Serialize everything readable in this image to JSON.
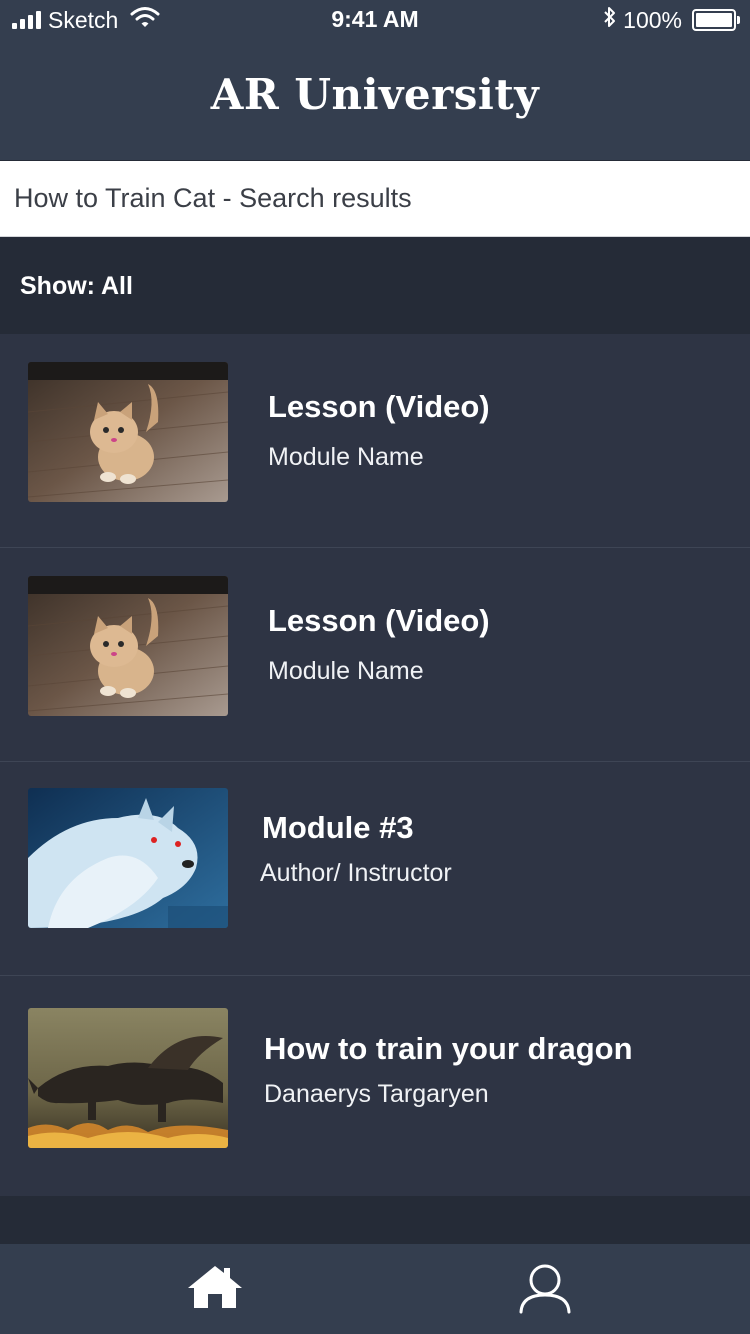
{
  "status_bar": {
    "carrier": "Sketch",
    "time": "9:41 AM",
    "battery": "100%"
  },
  "app_title": "AR University",
  "search": {
    "text": "How to Train Cat - Search results"
  },
  "filter": {
    "label": "Show: All"
  },
  "results": [
    {
      "title": "Lesson (Video)",
      "subtitle": "Module Name",
      "thumbnail": "kitten-photo"
    },
    {
      "title": "Lesson (Video)",
      "subtitle": "Module Name",
      "thumbnail": "kitten-photo"
    },
    {
      "title": "Module #3",
      "subtitle": "Author/ Instructor",
      "thumbnail": "white-wolf-photo"
    },
    {
      "title": "How to train your dragon",
      "subtitle": "Danaerys Targaryen",
      "thumbnail": "dragon-photo"
    }
  ],
  "tab_bar": {
    "items": [
      {
        "icon": "home-icon"
      },
      {
        "icon": "profile-icon"
      }
    ]
  },
  "colors": {
    "header_bg": "#343e4f",
    "row_bg": "#2e3444",
    "filter_bg": "#252b37"
  }
}
